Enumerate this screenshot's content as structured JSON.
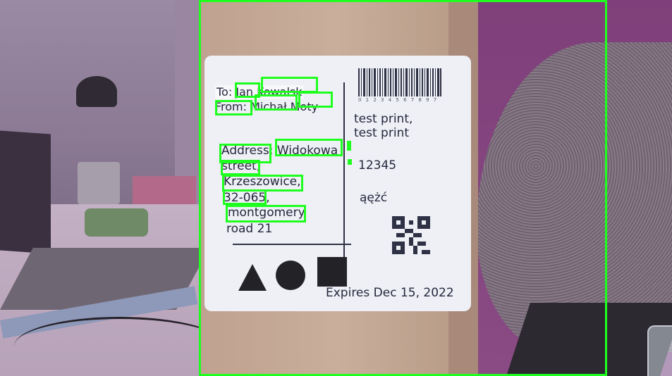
{
  "label": {
    "to_line": "To: Jan Kowalsk",
    "from_line": "From: Michał Moty",
    "address_lines": [
      "Address: Widokowa",
      "street,",
      "Krzeszowice,",
      "32-065,",
      "montgomery",
      "road 21"
    ],
    "barcode_digits": "0 1 2 3 4 5 6 7 8 9 7",
    "right_text_1": "test print,",
    "right_text_2": "test print",
    "right_number": "12345",
    "right_chars": "ąężć",
    "expires": "Expires Dec 15, 2022",
    "shapes": [
      "triangle",
      "circle",
      "square"
    ]
  },
  "detections": {
    "color": "#1fff1f",
    "boxes": [
      "outer-box",
      "word-jan",
      "word-kowalsk",
      "word-from",
      "word-michal",
      "word-moty",
      "word-address",
      "word-widokowa",
      "word-street",
      "word-krzeszowice",
      "word-postcode",
      "word-montgomery",
      "marker-1",
      "marker-2"
    ]
  }
}
